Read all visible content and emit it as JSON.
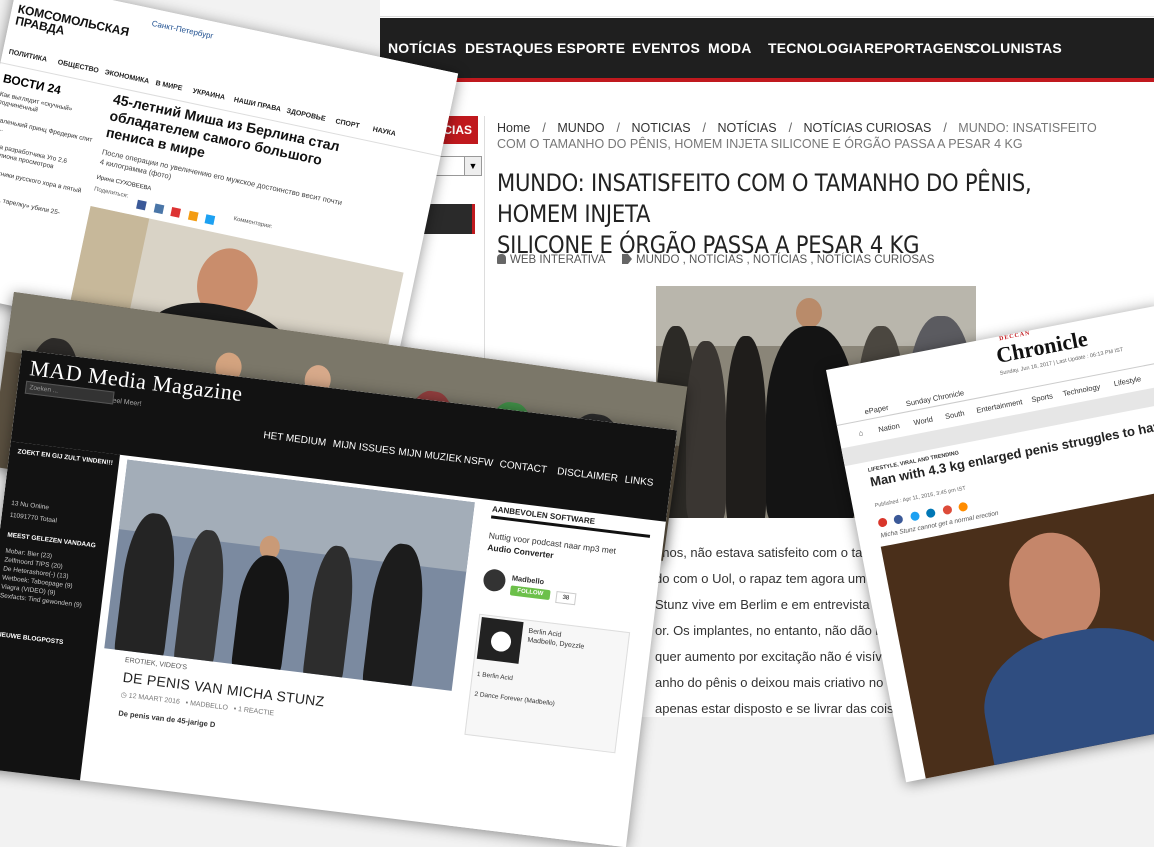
{
  "portuguese_site": {
    "nav": [
      "NOTÍCIAS",
      "DESTAQUES",
      "ESPORTE",
      "EVENTOS",
      "MODA",
      "TECNOLOGIA",
      "REPORTAGENS",
      "COLUNISTAS"
    ],
    "sidebar_heading": "TICIAS",
    "breadcrumbs": [
      "Home",
      "MUNDO",
      "NOTICIAS",
      "NOTÍCIAS",
      "NOTÍCIAS CURIOSAS"
    ],
    "breadcrumb_current": "MUNDO: INSATISFEITO COM O TAMANHO DO PÊNIS, HOMEM INJETA SILICONE E ÓRGÃO PASSA A PESAR 4 KG",
    "title_line1": "MUNDO: INSATISFEITO COM O TAMANHO DO PÊNIS, HOMEM INJETA",
    "title_line2": "SILICONE E ÓRGÃO PASSA A PESAR 4 KG",
    "author": "WEB INTERATIVA",
    "tags": "MUNDO , NOTICIAS , NOTÍCIAS , NOTÍCIAS CURIOSAS",
    "article_lines": [
      "anos, não estava satisfeito com o ta",
      "do com o Uol, o rapaz tem agora um m",
      "Stunz vive em Berlim e em entrevista",
      "or. Os implantes, no entanto, não dão nenh",
      "quer aumento por excitação não é visível c",
      "anho do pênis o deixou mais criativo no qu",
      "apenas estar disposto e se livrar das coisas p"
    ]
  },
  "russian_site": {
    "logo_line1": "КОМСОМОЛЬСКАЯ",
    "logo_line2": "ПРАВДА",
    "city": "Санкт-Петербург",
    "menu": [
      "ПОЛИТИКА",
      "ОБЩЕСТВО",
      "ЭКОНОМИКА",
      "В МИРЕ",
      "УКРАИНА",
      "НАШИ ПРАВА",
      "ЗДОРОВЬЕ",
      "СПОРТ",
      "НАУКА"
    ],
    "news24": "ВОСТИ 24",
    "side_items": [
      "Как выглядит «скучный» подчинённый",
      "Маленький принц Фредерик спит в ...",
      "Игра разработчика Уго 2,6 миллиона просмотров",
      "Участники русского хора в пятый раз",
      "В «Але, тарелку» убили 25-летнего"
    ],
    "headline": "45-летний Миша из Берлина стал обладателем самого большого пениса в мире",
    "lead": "После операции по увеличению его мужское достоинство весит почти 4 килограмма (фото)",
    "author": "Ирина СУХОВЕЕВА",
    "share_label": "Поделиться:",
    "comments_label": "Комментарии:"
  },
  "dutch_site": {
    "title": "MAD Media Magazine",
    "subtitle": "Nieuws Media Muziek en Veel Meer!",
    "nav": [
      "HET MEDIUM",
      "MIJN ISSUES",
      "MIJN MUZIEK",
      "NSFW",
      "CONTACT",
      "DISCLAIMER",
      "LINKS"
    ],
    "sidebar_search_heading": "ZOEKT EN GIJ ZULT VINDEN!!!",
    "search_placeholder": "Zoeken ...",
    "online": "13 Nu Online",
    "total": "11091770 Totaal",
    "most_read_heading": "MEEST GELEZEN VANDAAG",
    "most_read": [
      "Mobar: Bier (23)",
      "Zelfmoord TIPS (20)",
      "De Heterashore(-) (13)",
      "Wetboek: Taboepage (9)",
      "Viagra (VIDEO) (9)",
      "Sexfacts: Tind gewonden (9)"
    ],
    "new_posts_heading": "NIEUWE BLOGPOSTS",
    "category": "EROTIEK, VIDEO'S",
    "post_title": "DE PENIS VAN MICHA STUNZ",
    "post_date": "12 MAART 2016",
    "post_author": "MADBELLO",
    "post_reactions": "1 REACTIE",
    "post_body": "De penis van de 45-jarige D",
    "widget_heading": "AANBEVOLEN SOFTWARE",
    "widget_text": "Nuttig voor podcast naar mp3 met",
    "widget_bold": "Audio Converter",
    "author_name": "Madbello",
    "follow_label": "FOLLOW",
    "follow_count": "38",
    "player_track": "Berlin Acid",
    "player_artist": "Madbello, Dyezzle",
    "tracks": [
      "1  Berlin Acid",
      "2  Dance Forever (Madbello)"
    ]
  },
  "deccan_site": {
    "brand_small": "DECCAN",
    "brand": "Chronicle",
    "date": "Sunday, Jun 18, 2017 | Last Update : 06:13 PM IST",
    "tabs": [
      "ePaper",
      "Sunday Chronicle"
    ],
    "sections": [
      "Nation",
      "World",
      "South",
      "Entertainment",
      "Sports",
      "Technology",
      "Lifestyle"
    ],
    "kicker": "LIFESTYLE, VIRAL AND TRENDING",
    "headline": "Man with 4.3 kg enlarged penis struggles to have sex",
    "published": "Published : Apr 11, 2016, 3:45 pm IST",
    "quote": "Micha Stunz cannot get a normal erection"
  }
}
